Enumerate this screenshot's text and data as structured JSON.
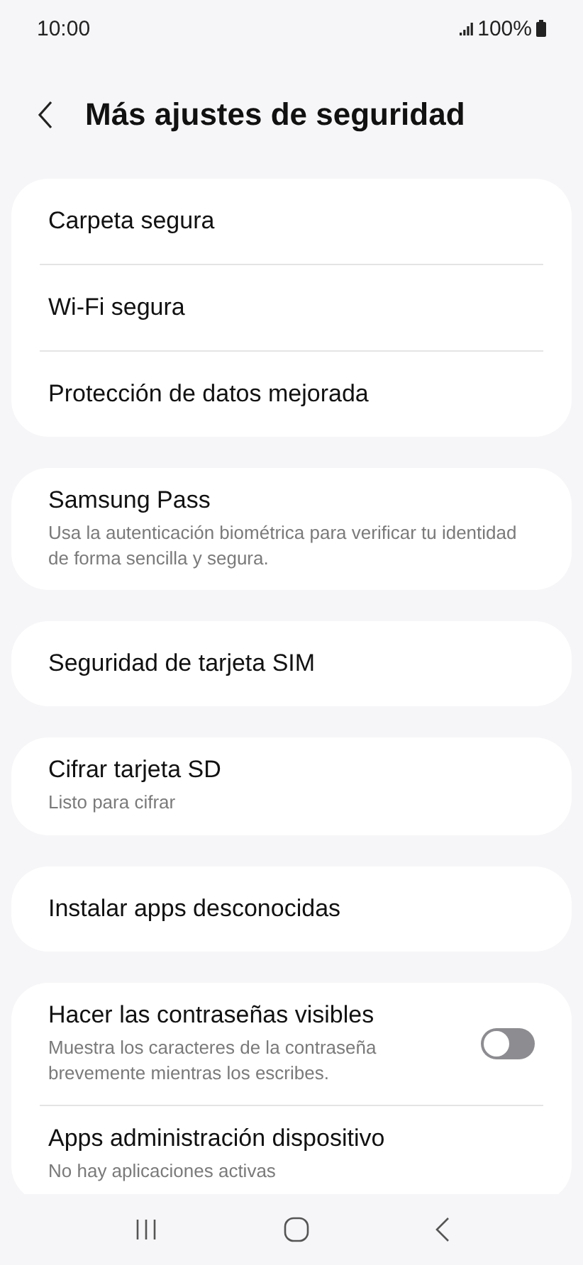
{
  "status_bar": {
    "time": "10:00",
    "battery": "100%"
  },
  "header": {
    "title": "Más ajustes de seguridad"
  },
  "groups": [
    {
      "items": [
        {
          "kind": "plain",
          "title": "Carpeta segura"
        },
        {
          "kind": "plain",
          "title": "Wi-Fi segura"
        },
        {
          "kind": "plain",
          "title": "Protección de datos mejorada"
        }
      ]
    },
    {
      "items": [
        {
          "kind": "plain",
          "title": "Samsung Pass",
          "subtitle": "Usa la autenticación biométrica para verificar tu identidad de forma sencilla y segura."
        }
      ]
    },
    {
      "items": [
        {
          "kind": "plain",
          "title": "Seguridad de tarjeta SIM"
        }
      ]
    },
    {
      "items": [
        {
          "kind": "plain",
          "title": "Cifrar tarjeta SD",
          "subtitle": "Listo para cifrar"
        }
      ]
    },
    {
      "items": [
        {
          "kind": "plain",
          "title": "Instalar apps desconocidas"
        }
      ]
    },
    {
      "items": [
        {
          "kind": "toggle",
          "title": "Hacer las contraseñas visibles",
          "subtitle": "Muestra los caracteres de la contraseña brevemente mientras los escribes.",
          "on": false
        },
        {
          "kind": "plain",
          "title": "Apps administración dispositivo",
          "subtitle": "No hay aplicaciones activas"
        }
      ]
    }
  ]
}
